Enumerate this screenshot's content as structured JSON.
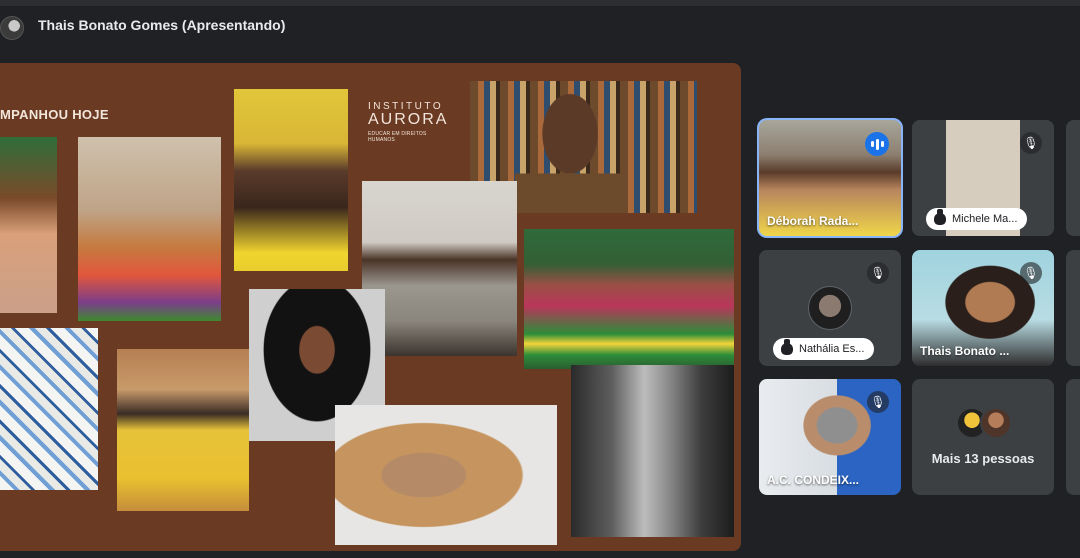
{
  "header": {
    "presenter_title": "Thais Bonato Gomes (Apresentando)"
  },
  "slide": {
    "heading": "MPANHOU HOJE",
    "logo_top": "INSTITUTO",
    "logo_main": "AURORA",
    "logo_sub": "EDUCAR EM DIREITOS HUMANOS"
  },
  "participants": [
    {
      "name": "Déborah Rada...",
      "speaking": true,
      "muted": false
    },
    {
      "name": "Michele Ma...",
      "muted": true,
      "raised_hand": true
    },
    {
      "name": "Nathália Es...",
      "muted": true,
      "raised_hand": true
    },
    {
      "name": "Thais Bonato ...",
      "muted": true
    },
    {
      "name": "A.C. CONDEIX...",
      "muted": true
    }
  ],
  "overflow": {
    "label": "Mais 13 pessoas"
  },
  "colors": {
    "background": "#202124",
    "tile_bg": "#3c4043",
    "active_outline": "#8ab4f8",
    "speaking_badge": "#1a73e8",
    "slide_bg": "#6b3a22"
  },
  "icons": {
    "mic_off": "mic-off-icon",
    "speaking": "speaking-indicator-icon",
    "raised_hand": "raised-hand-icon"
  }
}
